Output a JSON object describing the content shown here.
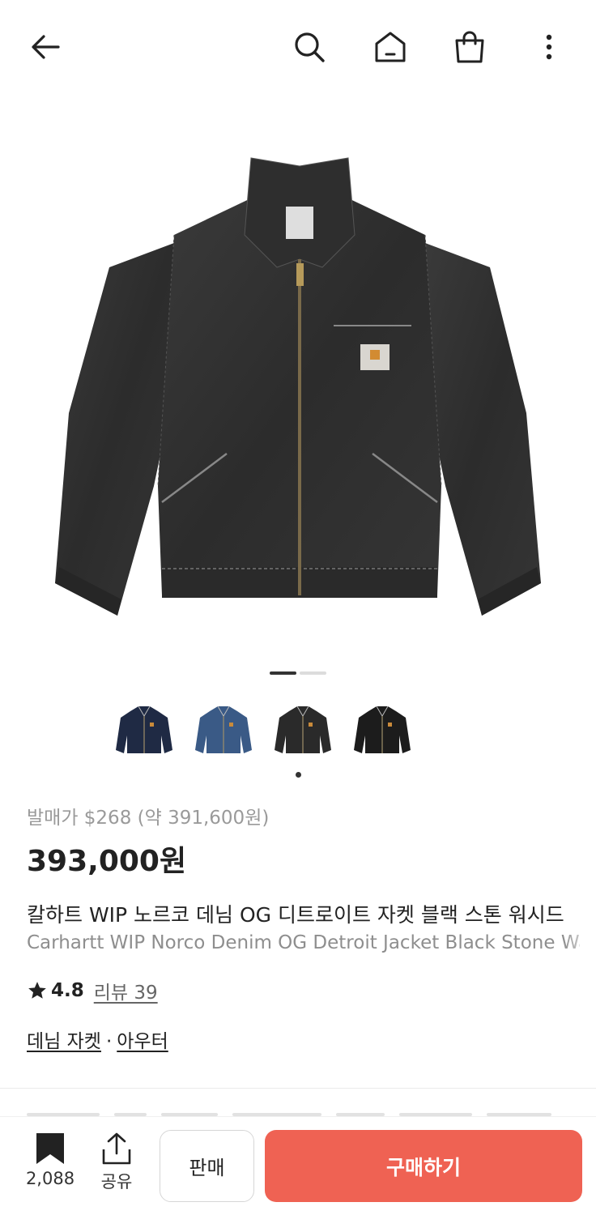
{
  "nav": {
    "back_icon": "arrow-left-icon",
    "search_icon": "search-icon",
    "home_icon": "home-icon",
    "bag_icon": "shopping-bag-icon",
    "more_icon": "more-vertical-icon"
  },
  "gallery": {
    "current_page": 1,
    "total_pages": 2,
    "thumbnails": [
      {
        "color": "#1f2a44",
        "name": "navy"
      },
      {
        "color": "#3a5a86",
        "name": "blue"
      },
      {
        "color": "#2a2a2a",
        "name": "black-stone"
      },
      {
        "color": "#1c1c1c",
        "name": "black"
      }
    ],
    "selected_thumbnail": 3
  },
  "product": {
    "release_price": "발매가 $268 (약 391,600원)",
    "price": "393,000원",
    "name_ko": "칼하트 WIP 노르코 데님 OG 디트로이트 자켓 블랙 스톤 워시드",
    "name_en": "Carhartt WIP Norco Denim OG Detroit Jacket Black Stone Washed",
    "rating": "4.8",
    "reviews": "리뷰 39",
    "category_1": "데님 자켓",
    "category_sep": "·",
    "category_2": "아우터"
  },
  "bottom_bar": {
    "bookmark_count": "2,088",
    "share_label": "공유",
    "sell_label": "판매",
    "buy_label": "구매하기"
  },
  "colors": {
    "accent": "#ef6253",
    "text": "#222222",
    "muted": "#9a9a9a"
  }
}
